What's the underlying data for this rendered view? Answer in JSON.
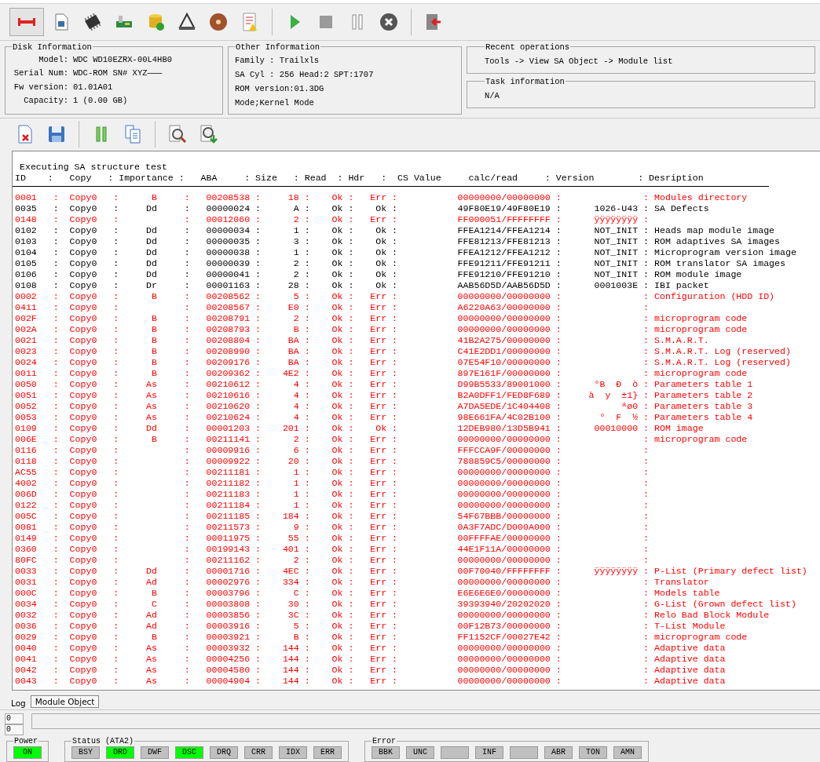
{
  "disk_information": {
    "title": "Disk Information",
    "fields": [
      {
        "label": "Model:",
        "value": "WDC WD10EZRX-00L4HB0"
      },
      {
        "label": "Serial Num:",
        "value": "WDC-ROM SN# XYZ———"
      },
      {
        "label": "Fw version:",
        "value": "01.01A01"
      },
      {
        "label": "Capacity:",
        "value": "1 (0.00 GB)"
      }
    ]
  },
  "other_information": {
    "title": "Other Information",
    "lines": [
      "Family  : Trailxls",
      "SA Cyl  : 256   Head:2   SPT:1707",
      "ROM version:01.3DG",
      "Mode;Kernel Mode"
    ]
  },
  "recent_operations": {
    "title": "Recent operations",
    "text": "Tools -> View SA Object -> Module list"
  },
  "task_information": {
    "title": "Task information",
    "text": "N/A"
  },
  "log": {
    "title": "Executing SA structure test",
    "header": "ID    :   Copy   : Importance :   ABA     : Size   : Read  : Hdr   :  CS Value     calc/read     : Version        : Desription",
    "separator": ":",
    "rows": [
      {
        "id": "0001",
        "copy": "Copy0",
        "importance": "B",
        "aba": "00208538",
        "size": "18",
        "read": "Ok",
        "hdr": "Err",
        "calc": "00000000/00000000",
        "description": "Modules directory",
        "error": true
      },
      {
        "id": "0035",
        "copy": "Copy0",
        "importance": "Dd",
        "aba": "00000024",
        "size": "A",
        "read": "Ok",
        "hdr": "Ok",
        "calc": "49F80E19/49F80E19",
        "version": "1026-U43",
        "description": "SA Defects",
        "error": false
      },
      {
        "id": "0148",
        "copy": "Copy0",
        "aba": "00012060",
        "size": "2",
        "read": "Ok",
        "hdr": "Err",
        "calc": "FF000051/FFFFFFFF",
        "version": "ÿÿÿÿÿÿÿÿ",
        "error": true
      },
      {
        "id": "0102",
        "copy": "Copy0",
        "importance": "Dd",
        "aba": "00000034",
        "size": "1",
        "read": "Ok",
        "hdr": "Ok",
        "calc": "FFEA1214/FFEA1214",
        "version": "NOT_INIT",
        "description": "Heads map module image",
        "error": false
      },
      {
        "id": "0103",
        "copy": "Copy0",
        "importance": "Dd",
        "aba": "00000035",
        "size": "3",
        "read": "Ok",
        "hdr": "Ok",
        "calc": "FFE81213/FFE81213",
        "version": "NOT_INIT",
        "description": "ROM adaptives SA images",
        "error": false
      },
      {
        "id": "0104",
        "copy": "Copy0",
        "importance": "Dd",
        "aba": "00000038",
        "size": "1",
        "read": "Ok",
        "hdr": "Ok",
        "calc": "FFEA1212/FFEA1212",
        "version": "NOT_INIT",
        "description": "Microprogram version image",
        "error": false
      },
      {
        "id": "0105",
        "copy": "Copy0",
        "importance": "Dd",
        "aba": "00000039",
        "size": "2",
        "read": "Ok",
        "hdr": "Ok",
        "calc": "FFE91211/FFE91211",
        "version": "NOT_INIT",
        "description": "ROM translator SA images",
        "error": false
      },
      {
        "id": "0106",
        "copy": "Copy0",
        "importance": "Dd",
        "aba": "00000041",
        "size": "2",
        "read": "Ok",
        "hdr": "Ok",
        "calc": "FFE91210/FFE91210",
        "version": "NOT_INIT",
        "description": "ROM module image",
        "error": false
      },
      {
        "id": "0108",
        "copy": "Copy0",
        "importance": "Dr",
        "aba": "00001163",
        "size": "28",
        "read": "Ok",
        "hdr": "Ok",
        "calc": "AAB56D5D/AAB56D5D",
        "version": "0001003E",
        "description": "IBI packet",
        "error": false
      },
      {
        "id": "0002",
        "copy": "Copy0",
        "importance": "B",
        "aba": "00208562",
        "size": "5",
        "read": "Ok",
        "hdr": "Err",
        "calc": "00000000/00000000",
        "description": "Configuration (HDD ID)",
        "error": true
      },
      {
        "id": "0411",
        "copy": "Copy0",
        "aba": "00208567",
        "size": "E0",
        "read": "Ok",
        "hdr": "Err",
        "calc": "A6220A63/00000000",
        "error": true
      },
      {
        "id": "002F",
        "copy": "Copy0",
        "importance": "B",
        "aba": "00208791",
        "size": "2",
        "read": "Ok",
        "hdr": "Err",
        "calc": "00000000/00000000",
        "description": "microprogram code",
        "error": true
      },
      {
        "id": "002A",
        "copy": "Copy0",
        "importance": "B",
        "aba": "00208793",
        "size": "B",
        "read": "Ok",
        "hdr": "Err",
        "calc": "00000000/00000000",
        "description": "microprogram code",
        "error": true
      },
      {
        "id": "0021",
        "copy": "Copy0",
        "importance": "B",
        "aba": "00208804",
        "size": "BA",
        "read": "Ok",
        "hdr": "Err",
        "calc": "41B2A275/00000000",
        "description": "S.M.A.R.T.",
        "error": true
      },
      {
        "id": "0023",
        "copy": "Copy0",
        "importance": "B",
        "aba": "00208990",
        "size": "BA",
        "read": "Ok",
        "hdr": "Err",
        "calc": "C41E2DD1/00000000",
        "description": "S.M.A.R.T. Log (reserved)",
        "error": true
      },
      {
        "id": "0024",
        "copy": "Copy0",
        "importance": "B",
        "aba": "00209176",
        "size": "BA",
        "read": "Ok",
        "hdr": "Err",
        "calc": "07E54F10/00000000",
        "description": "S.M.A.R.T. Log (reserved)",
        "error": true
      },
      {
        "id": "0011",
        "copy": "Copy0",
        "importance": "B",
        "aba": "00209362",
        "size": "4E2",
        "read": "Ok",
        "hdr": "Err",
        "calc": "897E161F/00000000",
        "description": "microprogram code",
        "error": true
      },
      {
        "id": "0050",
        "copy": "Copy0",
        "importance": "As",
        "aba": "00210612",
        "size": "4",
        "read": "Ok",
        "hdr": "Err",
        "calc": "D99B5533/89001000",
        "version": "°B  Ð  ò",
        "description": "Parameters table 1",
        "error": true
      },
      {
        "id": "0051",
        "copy": "Copy0",
        "importance": "As",
        "aba": "00210616",
        "size": "4",
        "read": "Ok",
        "hdr": "Err",
        "calc": "B2A0DFF1/FED8F689",
        "version": "à  y  ±1}",
        "description": "Parameters table 2",
        "error": true
      },
      {
        "id": "0052",
        "copy": "Copy0",
        "importance": "As",
        "aba": "00210620",
        "size": "4",
        "read": "Ok",
        "hdr": "Err",
        "calc": "A7DA5EDE/1C404408",
        "version": "ªø0",
        "description": "Parameters table 3",
        "error": true
      },
      {
        "id": "0053",
        "copy": "Copy0",
        "importance": "As",
        "aba": "00210624",
        "size": "4",
        "read": "Ok",
        "hdr": "Err",
        "calc": "98E661FA/4C02B100",
        "version": "°  F  ½",
        "description": "Parameters table 4",
        "error": true
      },
      {
        "id": "0109",
        "copy": "Copy0",
        "importance": "Dd",
        "aba": "00001203",
        "size": "201",
        "read": "Ok",
        "hdr": "Ok",
        "calc": "12DEB980/13D5B941",
        "version": "00010000",
        "description": "ROM image",
        "error": true
      },
      {
        "id": "006E",
        "copy": "Copy0",
        "importance": "B",
        "aba": "00211141",
        "size": "2",
        "read": "Ok",
        "hdr": "Err",
        "calc": "00000000/00000000",
        "description": "microprogram code",
        "error": true
      },
      {
        "id": "0116",
        "copy": "Copy0",
        "aba": "00009916",
        "size": "6",
        "read": "Ok",
        "hdr": "Err",
        "calc": "FFFCCA9F/00000000",
        "error": true
      },
      {
        "id": "0118",
        "copy": "Copy0",
        "aba": "00009922",
        "size": "20",
        "read": "Ok",
        "hdr": "Err",
        "calc": "788859C5/00000000",
        "error": true
      },
      {
        "id": "AC55",
        "copy": "Copy0",
        "aba": "00211181",
        "size": "1",
        "read": "Ok",
        "hdr": "Err",
        "calc": "00000000/00000000",
        "error": true
      },
      {
        "id": "4002",
        "copy": "Copy0",
        "aba": "00211182",
        "size": "1",
        "read": "Ok",
        "hdr": "Err",
        "calc": "00000000/00000000",
        "error": true
      },
      {
        "id": "006D",
        "copy": "Copy0",
        "aba": "00211183",
        "size": "1",
        "read": "Ok",
        "hdr": "Err",
        "calc": "00000000/00000000",
        "error": true
      },
      {
        "id": "0122",
        "copy": "Copy0",
        "aba": "00211184",
        "size": "1",
        "read": "Ok",
        "hdr": "Err",
        "calc": "00000000/00000000",
        "error": true
      },
      {
        "id": "005C",
        "copy": "Copy0",
        "aba": "00211185",
        "size": "184",
        "read": "Ok",
        "hdr": "Err",
        "calc": "54F67BBB/00000000",
        "error": true
      },
      {
        "id": "0081",
        "copy": "Copy0",
        "aba": "00211573",
        "size": "9",
        "read": "Ok",
        "hdr": "Err",
        "calc": "0A3F7ADC/D000A000",
        "error": true
      },
      {
        "id": "0149",
        "copy": "Copy0",
        "aba": "00011975",
        "size": "55",
        "read": "Ok",
        "hdr": "Err",
        "calc": "00FFFFAE/00000000",
        "error": true
      },
      {
        "id": "0360",
        "copy": "Copy0",
        "aba": "00199143",
        "size": "401",
        "read": "Ok",
        "hdr": "Err",
        "calc": "44E1F11A/00000000",
        "error": true
      },
      {
        "id": "80FC",
        "copy": "Copy0",
        "aba": "00211162",
        "size": "2",
        "read": "Ok",
        "hdr": "Err",
        "calc": "00000000/00000000",
        "error": true
      },
      {
        "id": "0033",
        "copy": "Copy0",
        "importance": "Dd",
        "aba": "00001716",
        "size": "4EC",
        "read": "Ok",
        "hdr": "Err",
        "calc": "00F70040/FFFFFFFF",
        "version": "ÿÿÿÿÿÿÿÿ",
        "description": "P-List (Primary defect list)",
        "error": true
      },
      {
        "id": "0031",
        "copy": "Copy0",
        "importance": "Ad",
        "aba": "00002976",
        "size": "334",
        "read": "Ok",
        "hdr": "Err",
        "calc": "00000000/00000000",
        "description": "Translator",
        "error": true
      },
      {
        "id": "000C",
        "copy": "Copy0",
        "importance": "B",
        "aba": "00003796",
        "size": "C",
        "read": "Ok",
        "hdr": "Err",
        "calc": "E6E6E6E0/00000000",
        "description": "Models table",
        "error": true
      },
      {
        "id": "0034",
        "copy": "Copy0",
        "importance": "C",
        "aba": "00003808",
        "size": "30",
        "read": "Ok",
        "hdr": "Err",
        "calc": "39393940/20202020",
        "description": "G-List (Grown defect list)",
        "error": true
      },
      {
        "id": "0032",
        "copy": "Copy0",
        "importance": "Ad",
        "aba": "00003856",
        "size": "3C",
        "read": "Ok",
        "hdr": "Err",
        "calc": "00000000/00000000",
        "description": "Relo Bad Block Module",
        "error": true
      },
      {
        "id": "0036",
        "copy": "Copy0",
        "importance": "Ad",
        "aba": "00003916",
        "size": "5",
        "read": "Ok",
        "hdr": "Err",
        "calc": "00F12B73/00000000",
        "description": "T-List Module",
        "error": true
      },
      {
        "id": "0029",
        "copy": "Copy0",
        "importance": "B",
        "aba": "00003921",
        "size": "B",
        "read": "Ok",
        "hdr": "Err",
        "calc": "FF1152CF/00027E42",
        "description": "microprogram code",
        "error": true
      },
      {
        "id": "0040",
        "copy": "Copy0",
        "importance": "As",
        "aba": "00003932",
        "size": "144",
        "read": "Ok",
        "hdr": "Err",
        "calc": "00000000/00000000",
        "description": "Adaptive data",
        "error": true
      },
      {
        "id": "0041",
        "copy": "Copy0",
        "importance": "As",
        "aba": "00004256",
        "size": "144",
        "read": "Ok",
        "hdr": "Err",
        "calc": "00000000/00000000",
        "description": "Adaptive data",
        "error": true
      },
      {
        "id": "0042",
        "copy": "Copy0",
        "importance": "As",
        "aba": "00004580",
        "size": "144",
        "read": "Ok",
        "hdr": "Err",
        "calc": "00000000/00000000",
        "description": "Adaptive data",
        "error": true
      },
      {
        "id": "0043",
        "copy": "Copy0",
        "importance": "As",
        "aba": "00004904",
        "size": "144",
        "read": "Ok",
        "hdr": "Err",
        "calc": "00000000/00000000",
        "description": "Adaptive data",
        "error": true
      }
    ]
  },
  "tabs": [
    {
      "label": "Log",
      "selected": true
    },
    {
      "label": "Module Object",
      "selected": false
    }
  ],
  "counters": [
    "0",
    "0"
  ],
  "status_bar": {
    "groups": [
      {
        "title": "Power",
        "indicators": [
          {
            "label": "ON",
            "on": true
          }
        ]
      },
      {
        "title": "Status (ATA2)",
        "indicators": [
          {
            "label": "BSY",
            "on": false
          },
          {
            "label": "DRD",
            "on": true
          },
          {
            "label": "DWF",
            "on": false
          },
          {
            "label": "DSC",
            "on": true
          },
          {
            "label": "DRQ",
            "on": false
          },
          {
            "label": "CRR",
            "on": false
          },
          {
            "label": "IDX",
            "on": false
          },
          {
            "label": "ERR",
            "on": false
          }
        ]
      },
      {
        "title": "Error",
        "indicators": [
          {
            "label": "BBK",
            "on": false
          },
          {
            "label": "UNC",
            "on": false
          },
          {
            "on": false
          },
          {
            "label": "INF",
            "on": false
          },
          {
            "on": false
          },
          {
            "label": "ABR",
            "on": false
          },
          {
            "label": "TON",
            "on": false
          },
          {
            "label": "AMN",
            "on": false
          }
        ]
      }
    ]
  }
}
